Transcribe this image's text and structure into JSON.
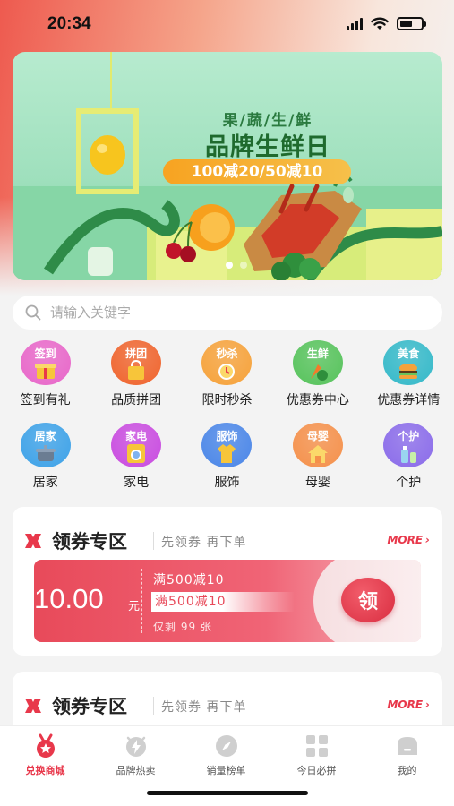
{
  "status_bar": {
    "time": "20:34"
  },
  "banner": {
    "subtitle": "果/蔬/生/鲜",
    "title": "品牌生鲜日",
    "promo": "100减20/50减10",
    "slides": 2,
    "active_slide": 1
  },
  "search": {
    "placeholder": "请输入关键字"
  },
  "categories": [
    {
      "tag": "签到",
      "label": "签到有礼",
      "icon": "gift-icon",
      "color": "#e866c9"
    },
    {
      "tag": "拼团",
      "label": "品质拼团",
      "icon": "shopping-bag-icon",
      "color": "#f0642d"
    },
    {
      "tag": "秒杀",
      "label": "限时秒杀",
      "icon": "alarm-clock-icon",
      "color": "#f6a23a"
    },
    {
      "tag": "生鲜",
      "label": "优惠券中心",
      "icon": "vegetables-icon",
      "color": "#56c35b"
    },
    {
      "tag": "美食",
      "label": "优惠券详情",
      "icon": "burger-icon",
      "color": "#34b9c9"
    },
    {
      "tag": "居家",
      "label": "居家",
      "icon": "cooking-pot-icon",
      "color": "#3da2e8"
    },
    {
      "tag": "家电",
      "label": "家电",
      "icon": "washing-machine-icon",
      "color": "#c94be0"
    },
    {
      "tag": "服饰",
      "label": "服饰",
      "icon": "shirt-icon",
      "color": "#4a86e8"
    },
    {
      "tag": "母婴",
      "label": "母婴",
      "icon": "baby-home-icon",
      "color": "#f5904a"
    },
    {
      "tag": "个护",
      "label": "个护",
      "icon": "skincare-bottle-icon",
      "color": "#8a6bea"
    }
  ],
  "coupon_sections": [
    {
      "title": "领券专区",
      "slogan": "先领券 再下单",
      "more": "MORE",
      "coupon": {
        "amount": "10.00",
        "unit": "元",
        "rule": "满500减10",
        "rule_highlight": "满500减10",
        "remaining": "仅剩 99 张",
        "claim": "领"
      }
    },
    {
      "title": "领券专区",
      "slogan": "先领券 再下单",
      "more": "MORE"
    }
  ],
  "tab_bar": [
    {
      "label": "兑换商城",
      "icon": "medal-star-icon",
      "active": true
    },
    {
      "label": "品牌热卖",
      "icon": "lightning-badge-icon",
      "active": false
    },
    {
      "label": "销量榜单",
      "icon": "compass-icon",
      "active": false
    },
    {
      "label": "今日必拼",
      "icon": "grid-icon",
      "active": false
    },
    {
      "label": "我的",
      "icon": "profile-card-icon",
      "active": false
    }
  ],
  "colors": {
    "accent": "#e8384b",
    "banner_green": "#1f6a2e",
    "promo_orange": "#f7a321"
  }
}
